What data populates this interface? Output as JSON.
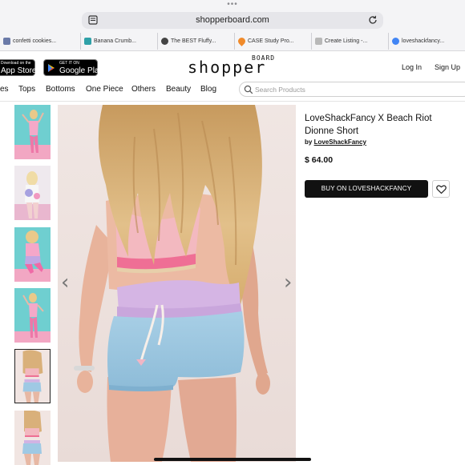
{
  "browser": {
    "url": "shopperboard.com",
    "tabs": [
      {
        "label": "confetti cookies...",
        "color": "#6a7aa8"
      },
      {
        "label": "Banana Crumb...",
        "color": "#2fa1a8"
      },
      {
        "label": "The BEST Fluffy...",
        "color": "#444444"
      },
      {
        "label": "CASE Study Pro...",
        "color": "#f08a2a"
      },
      {
        "label": "Create Listing -...",
        "color": "#b8b8b8"
      },
      {
        "label": "loveshackfancy...",
        "color": "#4285f4"
      }
    ]
  },
  "header": {
    "app_store": {
      "small": "Download on the",
      "big": "App Store"
    },
    "google_play": {
      "small": "GET IT ON",
      "big": "Google Play"
    },
    "logo_main": "shopper",
    "logo_sup": "BOARD",
    "login": "Log In",
    "signup": "Sign Up"
  },
  "nav": {
    "items": [
      "es",
      "Tops",
      "Bottoms",
      "One Piece",
      "Others",
      "Beauty",
      "Blog"
    ],
    "search_placeholder": "Search Products"
  },
  "product": {
    "title": "LoveShackFancy X Beach Riot Dionne Short",
    "by": "by",
    "brand": "LoveShackFancy",
    "price": "$ 64.00",
    "buy_label": "BUY ON LOVESHACKFANCY"
  },
  "gallery": {
    "prev_arrow": "‹",
    "next_arrow": "›",
    "selected_thumb": 5
  }
}
